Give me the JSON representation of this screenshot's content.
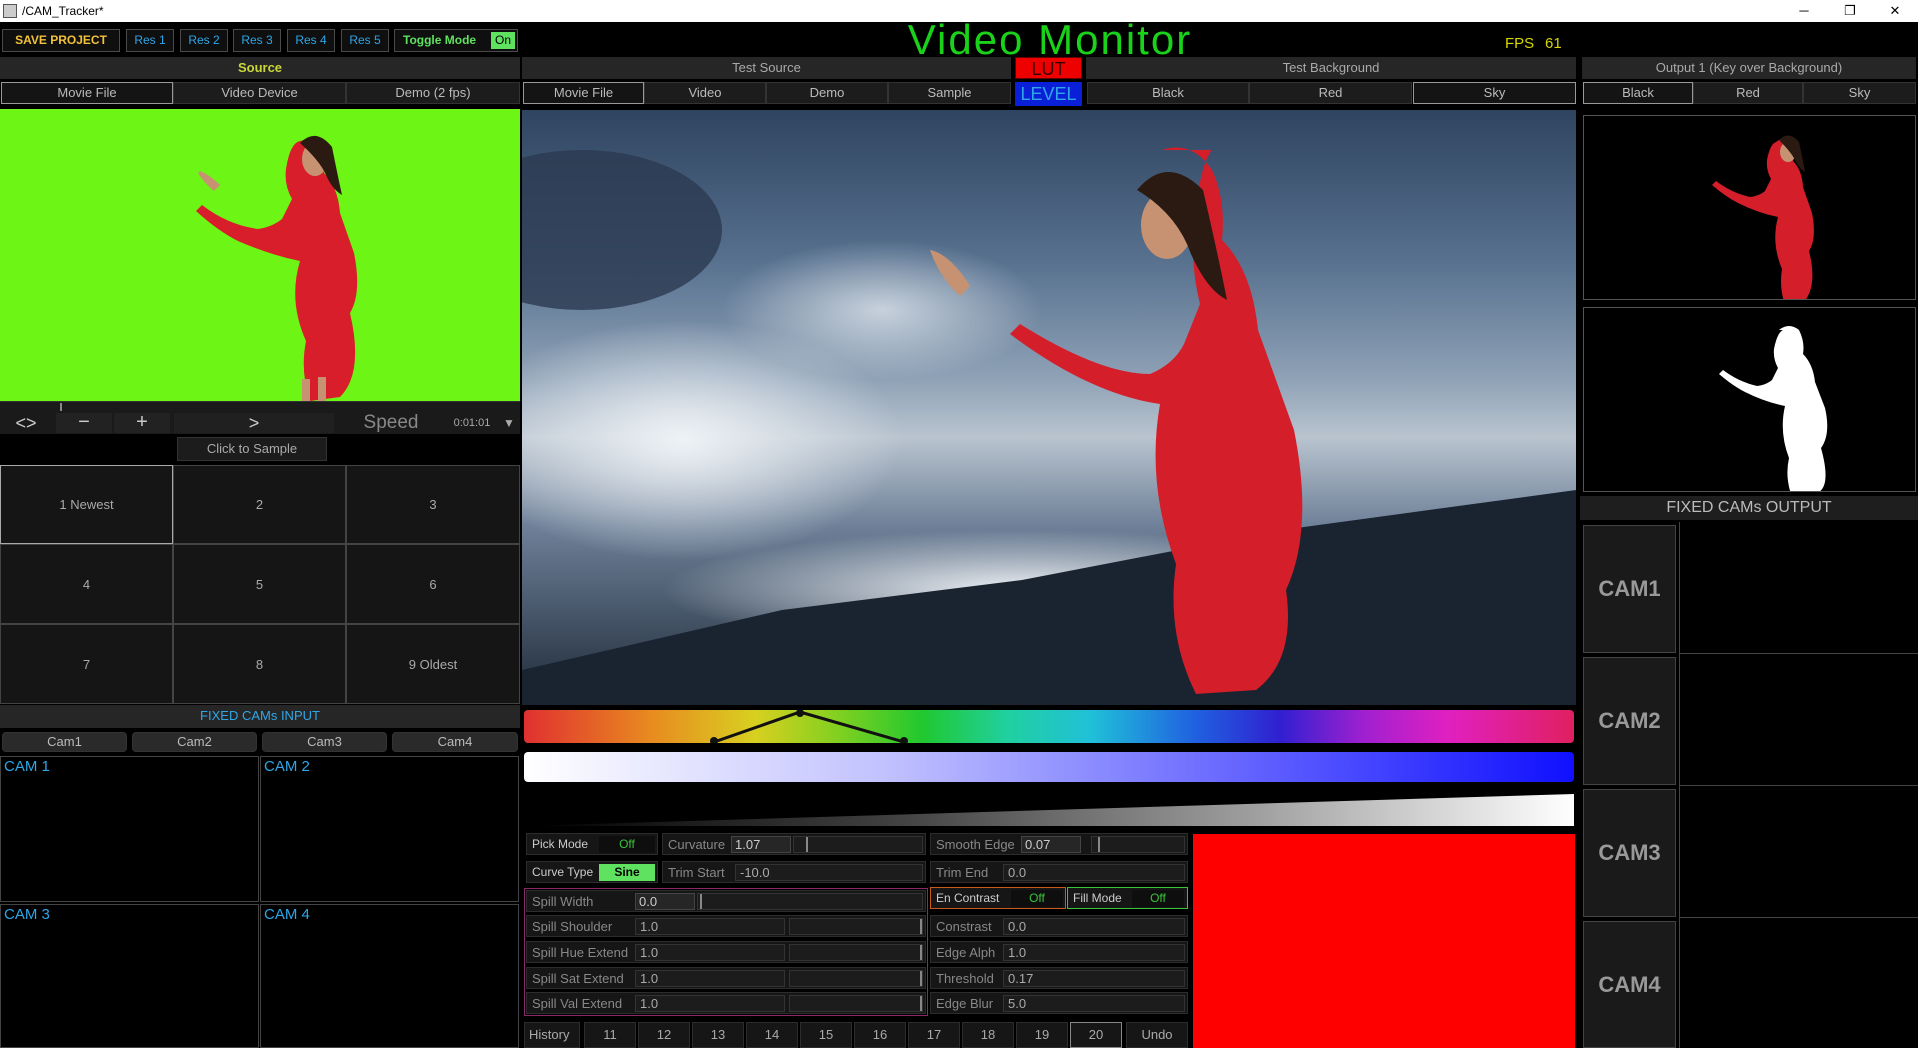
{
  "window": {
    "title": "/CAM_Tracker*",
    "controls": [
      "─",
      "❐",
      "✕"
    ]
  },
  "toolbar": {
    "save_project": "SAVE PROJECT",
    "res_buttons": [
      "Res 1",
      "Res 2",
      "Res 3",
      "Res 4",
      "Res 5"
    ],
    "toggle_mode_label": "Toggle Mode",
    "toggle_mode_state": "On"
  },
  "monitor": {
    "title": "Video Monitor",
    "fps_label": "FPS",
    "fps_value": "61",
    "lut_label": "LUT",
    "level_label": "LEVEL"
  },
  "source": {
    "header": "Source",
    "tabs": [
      "Movie File",
      "Video Device",
      "Demo (2 fps)"
    ],
    "selected_tab": 0,
    "transport": {
      "back_forward": "<>",
      "minus": "−",
      "plus": "+",
      "play": ">",
      "speed_label": "Speed",
      "timecode": "0:01:01"
    },
    "click_to_sample": "Click to Sample",
    "samples": [
      "1 Newest",
      "2",
      "3",
      "4",
      "5",
      "6",
      "7",
      "8",
      "9 Oldest"
    ]
  },
  "fixed_cams_input": {
    "header": "FIXED CAMs INPUT",
    "tabs": [
      "Cam1",
      "Cam2",
      "Cam3",
      "Cam4"
    ],
    "views": [
      "CAM 1",
      "CAM 2",
      "CAM 3",
      "CAM 4"
    ]
  },
  "test_source": {
    "header": "Test Source",
    "tabs": [
      "Movie File",
      "Video",
      "Demo",
      "Sample"
    ],
    "selected_tab": 0
  },
  "test_background": {
    "header": "Test Background",
    "tabs": [
      "Black",
      "Red",
      "Sky"
    ],
    "selected_tab": 2
  },
  "output": {
    "header": "Output 1 (Key over Background)",
    "tabs": [
      "Black",
      "Red",
      "Sky"
    ],
    "selected_tab": 0
  },
  "fixed_cams_output": {
    "header": "FIXED CAMs OUTPUT",
    "cams": [
      "CAM1",
      "CAM2",
      "CAM3",
      "CAM4"
    ]
  },
  "controls": {
    "pick_mode": {
      "label": "Pick Mode",
      "state": "Off"
    },
    "curvature": {
      "label": "Curvature",
      "value": "1.07"
    },
    "smooth_edge": {
      "label": "Smooth Edge",
      "value": "0.07"
    },
    "curve_type": {
      "label": "Curve Type",
      "state": "Sine"
    },
    "trim_start": {
      "label": "Trim Start",
      "value": "-10.0"
    },
    "trim_end": {
      "label": "Trim End",
      "value": "0.0"
    },
    "spill_width": {
      "label": "Spill Width",
      "value": "0.0"
    },
    "en_contrast": {
      "label": "En Contrast",
      "state": "Off"
    },
    "fill_mode": {
      "label": "Fill Mode",
      "state": "Off"
    },
    "spill_shoulder": {
      "label": "Spill Shoulder",
      "value": "1.0"
    },
    "constrast": {
      "label": "Constrast",
      "value": "0.0"
    },
    "spill_hue_extend": {
      "label": "Spill Hue Extend",
      "value": "1.0"
    },
    "edge_alph": {
      "label": "Edge Alph",
      "value": "1.0"
    },
    "spill_sat_extend": {
      "label": "Spill Sat Extend",
      "value": "1.0"
    },
    "threshold": {
      "label": "Threshold",
      "value": "0.17"
    },
    "spill_val_extend": {
      "label": "Spill Val Extend",
      "value": "1.0"
    },
    "edge_blur": {
      "label": "Edge Blur",
      "value": "5.0"
    }
  },
  "history": {
    "label": "History",
    "items": [
      "11",
      "12",
      "13",
      "14",
      "15",
      "16",
      "17",
      "18",
      "19",
      "20"
    ],
    "selected": "20",
    "undo": "Undo"
  },
  "colors": {
    "chroma_green": "#6cf515",
    "accent_blue": "#2fa6e8",
    "title_green": "#1ad21a",
    "fps_yellow": "#d7d700",
    "key_color_swatch": "#ff0000"
  }
}
